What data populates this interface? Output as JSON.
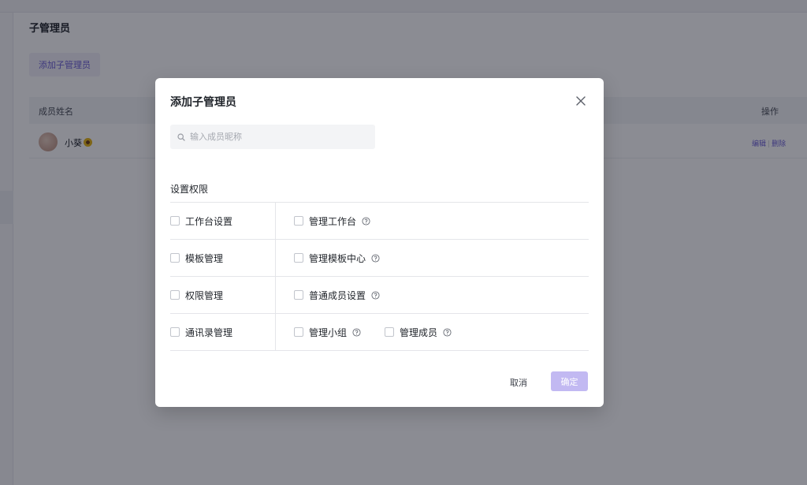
{
  "background": {
    "page_title": "子管理员",
    "add_button_label": "添加子管理员",
    "table": {
      "col_name": "成员姓名",
      "col_actions": "操作",
      "rows": [
        {
          "name": "小葵",
          "edit_label": "编辑",
          "delete_label": "删除"
        }
      ]
    }
  },
  "modal": {
    "title": "添加子管理员",
    "search_placeholder": "输入成员昵称",
    "section_label": "设置权限",
    "permissions": [
      {
        "group": "工作台设置",
        "children": [
          {
            "label": "管理工作台",
            "help": true
          }
        ]
      },
      {
        "group": "模板管理",
        "children": [
          {
            "label": "管理模板中心",
            "help": true
          }
        ]
      },
      {
        "group": "权限管理",
        "children": [
          {
            "label": "普通成员设置",
            "help": true
          }
        ]
      },
      {
        "group": "通讯录管理",
        "children": [
          {
            "label": "管理小组",
            "help": true
          },
          {
            "label": "管理成员",
            "help": true
          }
        ]
      }
    ],
    "cancel_label": "取消",
    "confirm_label": "确定"
  },
  "colors": {
    "accent": "#6b5fd6",
    "confirm_disabled": "#c2b9f2",
    "overlay": "rgba(12,14,30,0.48)"
  },
  "icons": {
    "close": "close-icon",
    "search": "search-icon",
    "help": "help-circle-icon"
  }
}
